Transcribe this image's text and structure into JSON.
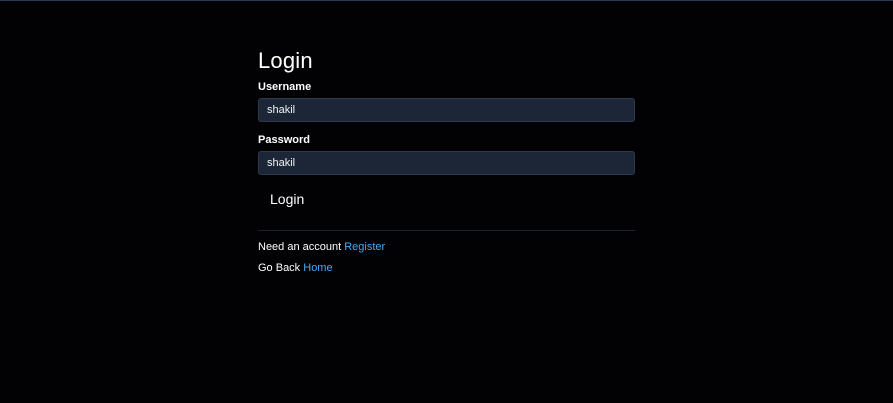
{
  "login_form": {
    "title": "Login",
    "username_label": "Username",
    "username_value": "shakil",
    "password_label": "Password",
    "password_value": "shakil",
    "submit_label": "Login"
  },
  "footer": {
    "register_prompt": "Need an account",
    "register_link": "Register",
    "back_prompt": "Go Back",
    "home_link": "Home"
  },
  "colors": {
    "background": "#020204",
    "input_background": "#1d2636",
    "link": "#4aa8f0"
  }
}
